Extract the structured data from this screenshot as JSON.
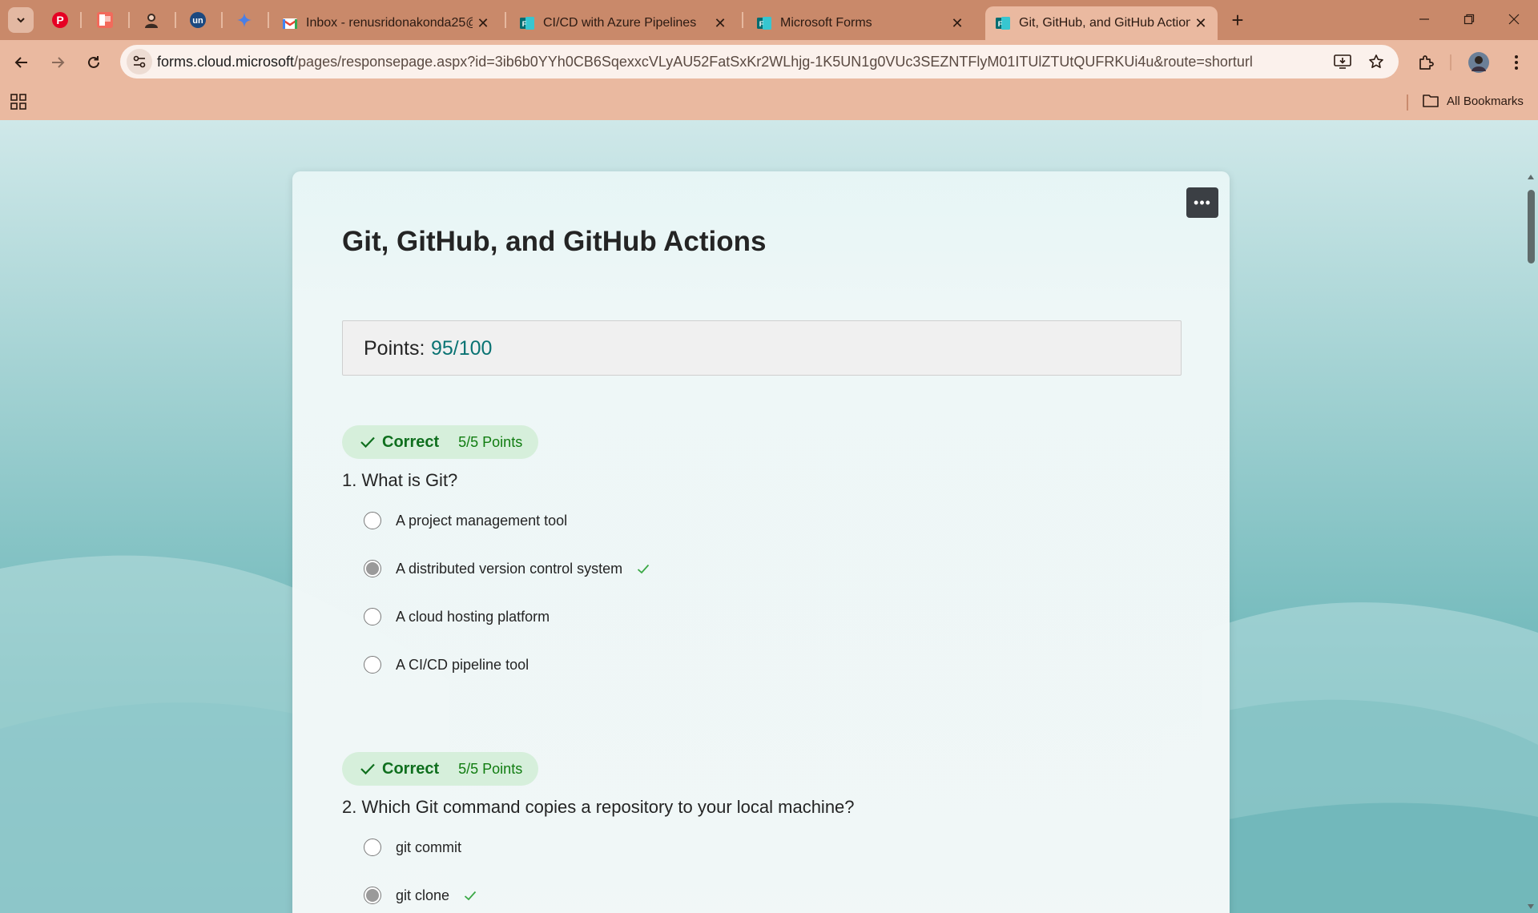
{
  "browser": {
    "tabs": [
      {
        "title": "Inbox - renusridonakonda25@",
        "icon": "gmail-icon"
      },
      {
        "title": "CI/CD with Azure Pipelines",
        "icon": "forms-icon"
      },
      {
        "title": "Microsoft Forms",
        "icon": "forms-icon"
      },
      {
        "title": "Git, GitHub, and GitHub Actions",
        "icon": "forms-icon",
        "active": true
      }
    ],
    "pinned_tabs": [
      "pinterest-icon",
      "pixel-app-icon",
      "avatar-app-icon",
      "unstop-icon",
      "gemini-icon"
    ],
    "url_host": "forms.cloud.microsoft",
    "url_path": "/pages/responsepage.aspx?id=3ib6b0YYh0CB6SqexxcVLyAU52FatSxKr2WLhjg-1K5UN1g0VUc3SEZNTFlyM01ITUlZTUtQUFRKUi4u&route=shorturl",
    "all_bookmarks": "All Bookmarks"
  },
  "form": {
    "title": "Git, GitHub, and GitHub Actions",
    "points_label": "Points:",
    "points_value": "95/100",
    "questions": [
      {
        "number": "1.",
        "text": "What is Git?",
        "status": "Correct",
        "points": "5/5 Points",
        "options": [
          {
            "text": "A project management tool",
            "selected": false
          },
          {
            "text": "A distributed version control system",
            "selected": true,
            "correct": true
          },
          {
            "text": "A cloud hosting platform",
            "selected": false
          },
          {
            "text": "A CI/CD pipeline tool",
            "selected": false
          }
        ]
      },
      {
        "number": "2.",
        "text": "Which Git command copies a repository to your local machine?",
        "status": "Correct",
        "points": "5/5 Points",
        "options": [
          {
            "text": "git commit",
            "selected": false
          },
          {
            "text": "git clone",
            "selected": true,
            "correct": true
          }
        ]
      }
    ]
  },
  "colors": {
    "tabstrip": "#c9896a",
    "toolbar": "#eab9a0",
    "correct_bg": "#d6efdb",
    "correct_text": "#0f6f1e",
    "points_accent": "#0a7373"
  }
}
